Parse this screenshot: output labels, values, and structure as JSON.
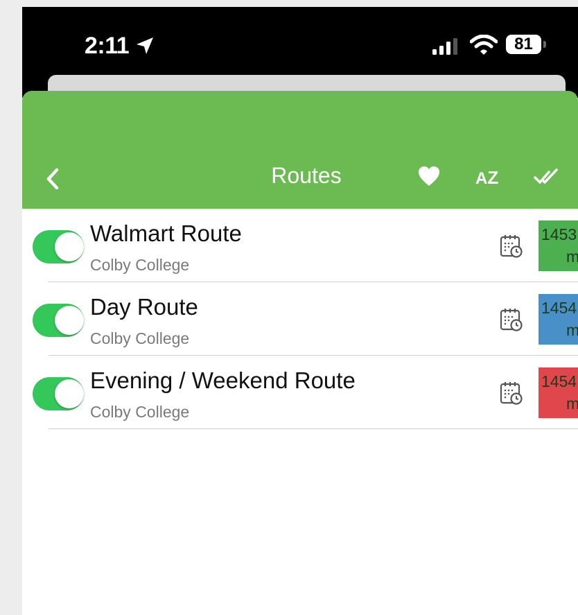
{
  "status_bar": {
    "time": "2:11",
    "battery": "81"
  },
  "nav": {
    "title": "Routes",
    "icons": [
      "chevron-left-icon",
      "heart-icon",
      "sort-az-icon",
      "double-check-icon"
    ],
    "color": "#6cbb52"
  },
  "routes": [
    {
      "name": "Walmart Route",
      "subtitle": "Colby College",
      "eta_top": "1453",
      "eta_unit": "mi",
      "badge_color": "#4caf50",
      "enabled": true
    },
    {
      "name": "Day Route",
      "subtitle": "Colby College",
      "eta_top": "1454",
      "eta_unit": "mi",
      "badge_color": "#4a90c8",
      "enabled": true
    },
    {
      "name": "Evening / Weekend Route",
      "subtitle": "Colby College",
      "eta_top": "1454",
      "eta_unit": "mi",
      "badge_color": "#e0474c",
      "enabled": true
    }
  ],
  "colors": {
    "toggle_on": "#34c759"
  }
}
